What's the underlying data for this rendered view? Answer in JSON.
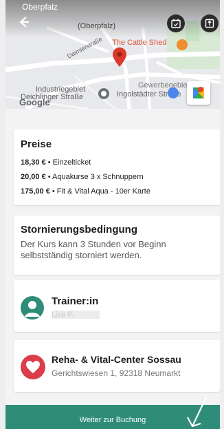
{
  "map": {
    "labels": {
      "region_top": "Oberpfalz",
      "region_small": "(Oberpfalz)",
      "street_daimler": "Daimlerstraße",
      "poi_cattle_shed": "The Cattle Shed",
      "industrial_area": "Industriegebiet",
      "street_deichlinger": "Deichlinger Straße",
      "gewerbegebiet": "Gewerbegebiet",
      "ingolstaedter": "Ingolstädter Straße"
    },
    "attribution": "Google"
  },
  "prices": {
    "title": "Preise",
    "items": [
      {
        "amount": "18,30 €",
        "label": " • Einzelticket"
      },
      {
        "amount": "20,00 €",
        "label": " • Aquakurse 3 x Schnuppern"
      },
      {
        "amount": "175,00 €",
        "label": " • Fit & Vital Aqua - 10er Karte"
      }
    ]
  },
  "cancellation": {
    "title": "Stornierungsbedingung",
    "text": "Der Kurs kann 3 Stunden vor Beginn selbstständig storniert werden."
  },
  "trainer": {
    "title": "Trainer:in",
    "name": "Lisa P."
  },
  "location": {
    "title": "Reha- & Vital-Center Sossau",
    "address": "Gerichtswiesen 1, 92318 Neumarkt"
  },
  "cta": {
    "label": "Weiter zur Buchung"
  },
  "colors": {
    "accent": "#2e8c78",
    "heart": "#dc3d4b",
    "pin": "#d93a2b"
  },
  "icons": [
    "back-arrow-icon",
    "calendar-icon",
    "share-icon",
    "map-pin-icon",
    "heart-icon",
    "person-icon",
    "swipe-arrow-icon"
  ]
}
